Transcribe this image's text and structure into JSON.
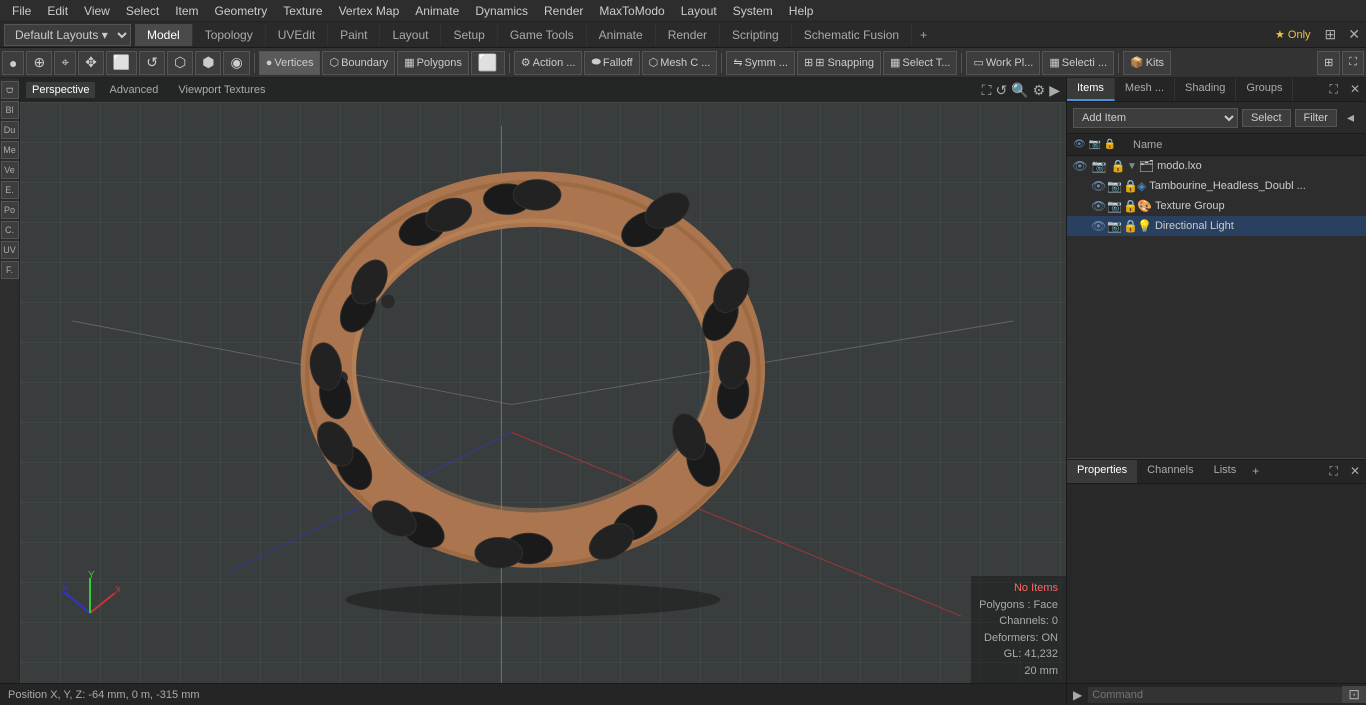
{
  "menubar": {
    "items": [
      "File",
      "Edit",
      "View",
      "Select",
      "Item",
      "Geometry",
      "Texture",
      "Vertex Map",
      "Animate",
      "Dynamics",
      "Render",
      "MaxToModo",
      "Layout",
      "System",
      "Help"
    ]
  },
  "layout_bar": {
    "dropdown_label": "Default Layouts",
    "tabs": [
      "Model",
      "Topology",
      "UVEdit",
      "Paint",
      "Layout",
      "Setup",
      "Game Tools",
      "Animate",
      "Render",
      "Scripting",
      "Schematic Fusion"
    ],
    "active_tab": "Model",
    "star_label": "★ Only",
    "plus_icon": "+"
  },
  "toolbar": {
    "tools": [
      {
        "label": "●",
        "name": "dot-tool"
      },
      {
        "label": "⊕",
        "name": "crosshair-tool"
      },
      {
        "label": "⌖",
        "name": "target-tool"
      },
      {
        "label": "↔",
        "name": "move-tool"
      },
      {
        "label": "⊡",
        "name": "box-tool"
      },
      {
        "label": "↺",
        "name": "rotate-tool"
      },
      {
        "label": "⬡",
        "name": "hex-tool"
      },
      {
        "label": "⬢",
        "name": "hex2-tool"
      },
      {
        "label": "◉",
        "name": "circle-tool"
      }
    ],
    "vertices_label": "Vertices",
    "boundary_label": "Boundary",
    "polygons_label": "Polygons",
    "action_label": "Action ...",
    "falloff_label": "Falloff",
    "mesh_c_label": "Mesh C ...",
    "symm_label": "Symm ...",
    "snapping_label": "⊞ Snapping",
    "select_t_label": "Select T...",
    "work_pl_label": "Work Pl...",
    "selecti_label": "Selecti ...",
    "kits_label": "Kits"
  },
  "viewport": {
    "tabs": [
      "Perspective",
      "Advanced",
      "Viewport Textures"
    ],
    "active_tab": "Perspective",
    "status": {
      "no_items": "No Items",
      "polygons": "Polygons : Face",
      "channels": "Channels: 0",
      "deformers": "Deformers: ON",
      "gl": "GL: 41,232",
      "size": "20 mm"
    },
    "position_text": "Position X, Y, Z:  -64 mm, 0 m, -315 mm"
  },
  "right_panel": {
    "tabs": [
      "Items",
      "Mesh ...",
      "Shading",
      "Groups"
    ],
    "active_tab": "Items",
    "add_item_label": "Add Item",
    "select_btn": "Select",
    "filter_btn": "Filter",
    "name_col": "Name",
    "scene_items": [
      {
        "id": "modo-lxo",
        "label": "modo.lxo",
        "indent": 0,
        "icon": "🗂",
        "has_arrow": true,
        "type": "scene"
      },
      {
        "id": "tambourine",
        "label": "Tambourine_Headless_Doubl ...",
        "indent": 1,
        "icon": "🔷",
        "has_arrow": false,
        "type": "mesh"
      },
      {
        "id": "texture-group",
        "label": "Texture Group",
        "indent": 1,
        "icon": "🎨",
        "has_arrow": false,
        "type": "texture"
      },
      {
        "id": "directional-light",
        "label": "Directional Light",
        "indent": 1,
        "icon": "💡",
        "has_arrow": false,
        "type": "light",
        "selected": true
      }
    ]
  },
  "properties_panel": {
    "tabs": [
      "Properties",
      "Channels",
      "Lists"
    ],
    "active_tab": "Properties",
    "plus_icon": "+"
  },
  "status_bar": {
    "position_text": "Position X, Y, Z:  -64 mm, 0 m, -315 mm"
  },
  "command_bar": {
    "placeholder": "Command",
    "arrow": "▶"
  }
}
